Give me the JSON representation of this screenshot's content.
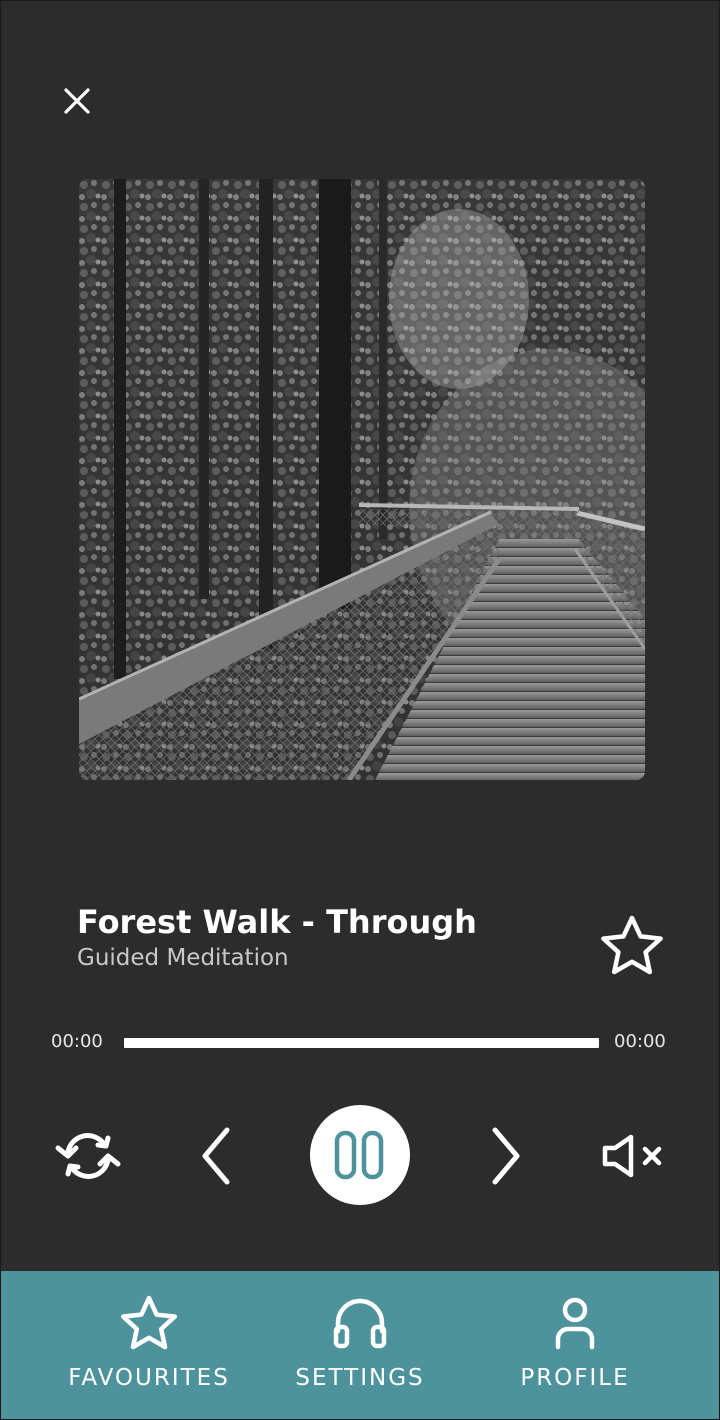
{
  "header": {
    "close_icon": "close-icon"
  },
  "artwork": {
    "description_icon": "forest-boardwalk-image"
  },
  "track": {
    "title": "Forest Walk - Through",
    "subtitle": "Guided Meditation",
    "favourite_icon": "star-outline-icon"
  },
  "progress": {
    "current_time": "00:00",
    "total_time": "00:00",
    "fraction": 0
  },
  "controls": {
    "repeat_icon": "repeat-icon",
    "previous_icon": "chevron-left-icon",
    "play_pause_icon": "pause-icon",
    "next_icon": "chevron-right-icon",
    "mute_icon": "volume-mute-icon"
  },
  "bottom_nav": {
    "items": [
      {
        "label": "FAVOURITES",
        "icon": "star-icon"
      },
      {
        "label": "SETTINGS",
        "icon": "headphones-icon"
      },
      {
        "label": "PROFILE",
        "icon": "user-icon"
      }
    ]
  },
  "colors": {
    "background": "#2c2c2c",
    "accent": "#4e939b",
    "text": "#ffffff",
    "muted_text": "#c9c9c9"
  }
}
